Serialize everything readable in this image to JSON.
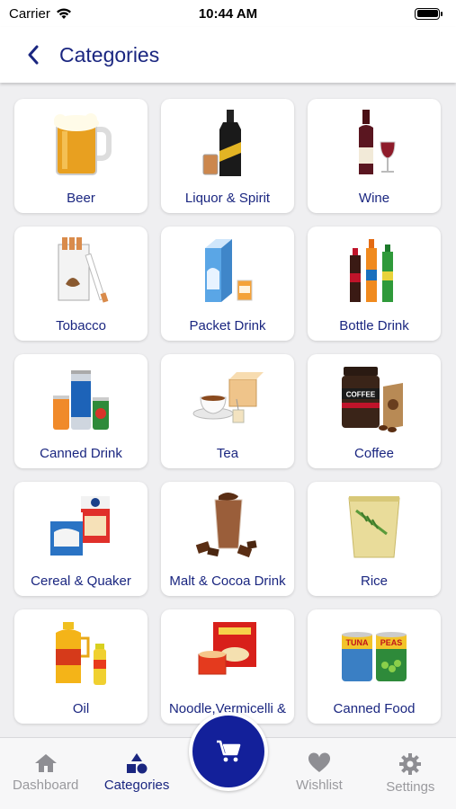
{
  "status_bar": {
    "carrier": "Carrier",
    "time": "10:44 AM"
  },
  "header": {
    "title": "Categories"
  },
  "categories": [
    {
      "label": "Beer"
    },
    {
      "label": "Liquor & Spirit"
    },
    {
      "label": "Wine"
    },
    {
      "label": "Tobacco"
    },
    {
      "label": "Packet Drink"
    },
    {
      "label": "Bottle Drink"
    },
    {
      "label": "Canned Drink"
    },
    {
      "label": "Tea"
    },
    {
      "label": "Coffee"
    },
    {
      "label": "Cereal & Quaker"
    },
    {
      "label": "Malt & Cocoa Drink"
    },
    {
      "label": "Rice"
    },
    {
      "label": "Oil"
    },
    {
      "label": "Noodle,Vermicelli &"
    },
    {
      "label": "Canned Food"
    }
  ],
  "product_text": {
    "coffee_jar": "COFFEE",
    "tuna_can": "TUNA",
    "peas_can": "PEAS"
  },
  "tabbar": {
    "dashboard": "Dashboard",
    "categories": "Categories",
    "wishlist": "Wishlist",
    "settings": "Settings"
  },
  "colors": {
    "accent": "#1a2680",
    "fab": "#13209a",
    "inactive": "#9a9a9e"
  }
}
